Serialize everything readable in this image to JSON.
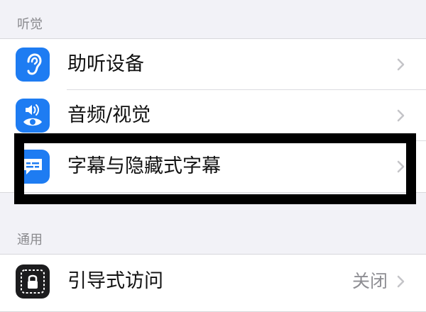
{
  "sections": {
    "hearing": {
      "header": "听觉"
    },
    "general": {
      "header": "通用"
    }
  },
  "rows": {
    "hearing_devices": {
      "label": "助听设备",
      "icon": "ear-icon"
    },
    "audio_visual": {
      "label": "音频/视觉",
      "icon": "speaker-eye-icon"
    },
    "subtitles": {
      "label": "字幕与隐藏式字幕",
      "icon": "caption-bubble-icon"
    },
    "guided_access": {
      "label": "引导式访问",
      "value": "关闭",
      "icon": "lock-icon"
    }
  },
  "colors": {
    "accent_blue": "#1e7cf2",
    "guided_access_bg": "#1c1c1e",
    "background": "#f2f2f7",
    "highlight_box": "#000000"
  }
}
